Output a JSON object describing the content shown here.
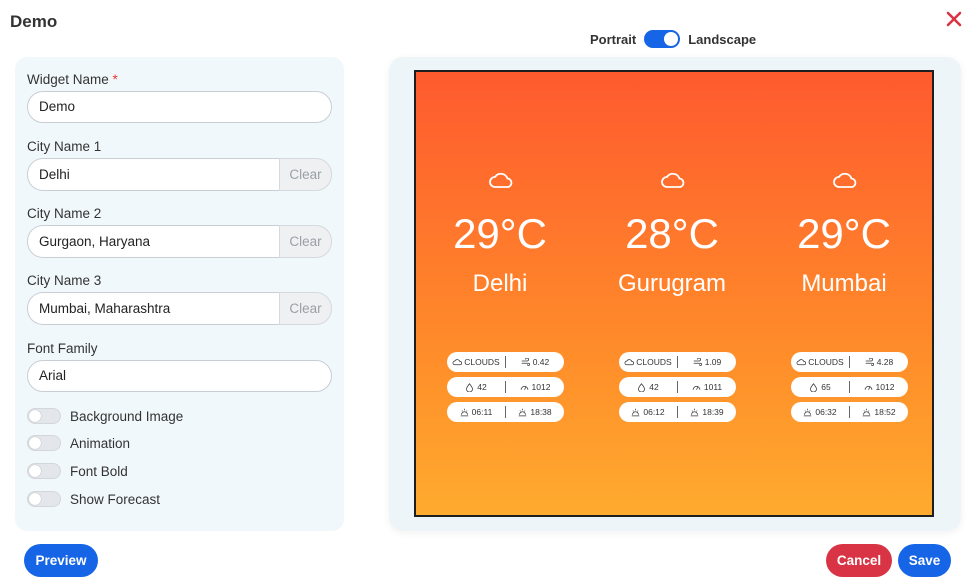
{
  "dialog": {
    "title": "Demo"
  },
  "orientation": {
    "portrait_label": "Portrait",
    "landscape_label": "Landscape",
    "selected": "Landscape"
  },
  "form": {
    "widget_name": {
      "label": "Widget Name",
      "required_mark": "*",
      "value": "Demo"
    },
    "city1": {
      "label": "City Name 1",
      "value": "Delhi",
      "clear_label": "Clear"
    },
    "city2": {
      "label": "City Name 2",
      "value": "Gurgaon, Haryana",
      "clear_label": "Clear"
    },
    "city3": {
      "label": "City Name 3",
      "value": "Mumbai, Maharashtra",
      "clear_label": "Clear"
    },
    "font_family": {
      "label": "Font Family",
      "value": "Arial"
    },
    "toggles": [
      {
        "label": "Background Image",
        "on": false
      },
      {
        "label": "Animation",
        "on": false
      },
      {
        "label": "Font Bold",
        "on": false
      },
      {
        "label": "Show Forecast",
        "on": false
      }
    ]
  },
  "buttons": {
    "preview": "Preview",
    "cancel": "Cancel",
    "save": "Save"
  },
  "preview": {
    "cities": [
      {
        "temp": "29°C",
        "name": "Delhi",
        "condition": "CLOUDS",
        "wind": "0.42",
        "humidity": "42",
        "pressure": "1012",
        "sunrise": "06:11",
        "sunset": "18:38"
      },
      {
        "temp": "28°C",
        "name": "Gurugram",
        "condition": "CLOUDS",
        "wind": "1.09",
        "humidity": "42",
        "pressure": "1011",
        "sunrise": "06:12",
        "sunset": "18:39"
      },
      {
        "temp": "29°C",
        "name": "Mumbai",
        "condition": "CLOUDS",
        "wind": "4.28",
        "humidity": "65",
        "pressure": "1012",
        "sunrise": "06:32",
        "sunset": "18:52"
      }
    ]
  },
  "colors": {
    "accent": "#1565e6",
    "danger": "#d93445",
    "gradient_top": "#ff5a2e",
    "gradient_bottom": "#ffab2e"
  }
}
